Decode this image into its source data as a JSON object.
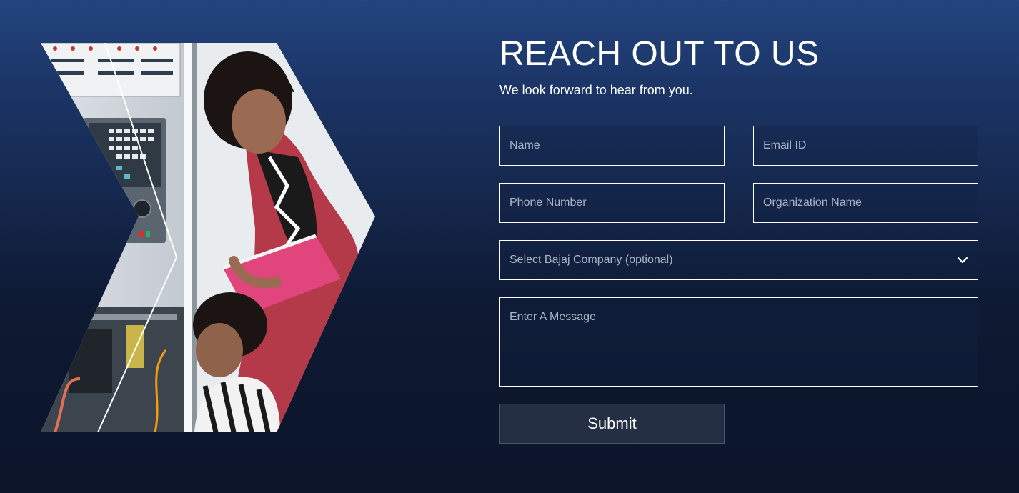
{
  "header": {
    "title": "REACH OUT TO US",
    "subtitle": "We look forward to hear from you."
  },
  "form": {
    "name_placeholder": "Name",
    "email_placeholder": "Email ID",
    "phone_placeholder": "Phone Number",
    "organization_placeholder": "Organization Name",
    "company_select_label": "Select Bajaj Company (optional)",
    "message_placeholder": "Enter A Message",
    "submit_label": "Submit"
  },
  "icons": {
    "dropdown": "chevron-down-icon"
  },
  "colors": {
    "background_top": "#22447f",
    "background_bottom": "#0b1429",
    "field_border": "#ffffff",
    "button_background": "#242f44"
  }
}
